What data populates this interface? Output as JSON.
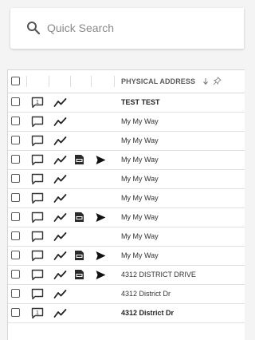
{
  "search": {
    "placeholder": "Quick Search",
    "value": ""
  },
  "grid": {
    "column_header": "PHYSICAL ADDRESS",
    "sort": "descending",
    "rows": [
      {
        "address": "TEST TEST",
        "bold": true,
        "note": "count",
        "note_count": "1",
        "has_pdf": false,
        "has_send": false
      },
      {
        "address": "My My Way",
        "bold": false,
        "note": "empty",
        "note_count": "",
        "has_pdf": false,
        "has_send": false
      },
      {
        "address": "My My Way",
        "bold": false,
        "note": "empty",
        "note_count": "",
        "has_pdf": false,
        "has_send": false
      },
      {
        "address": "My My Way",
        "bold": false,
        "note": "empty",
        "note_count": "",
        "has_pdf": true,
        "has_send": true
      },
      {
        "address": "My My Way",
        "bold": false,
        "note": "empty",
        "note_count": "",
        "has_pdf": false,
        "has_send": false
      },
      {
        "address": "My My Way",
        "bold": false,
        "note": "empty",
        "note_count": "",
        "has_pdf": false,
        "has_send": false
      },
      {
        "address": "My My Way",
        "bold": false,
        "note": "empty",
        "note_count": "",
        "has_pdf": true,
        "has_send": true
      },
      {
        "address": "My My Way",
        "bold": false,
        "note": "empty",
        "note_count": "",
        "has_pdf": false,
        "has_send": false
      },
      {
        "address": "My My Way",
        "bold": false,
        "note": "empty",
        "note_count": "",
        "has_pdf": true,
        "has_send": true
      },
      {
        "address": "4312 DISTRICT DRIVE",
        "bold": false,
        "note": "empty",
        "note_count": "",
        "has_pdf": true,
        "has_send": true
      },
      {
        "address": "4312 District Dr",
        "bold": false,
        "note": "empty",
        "note_count": "",
        "has_pdf": false,
        "has_send": false
      },
      {
        "address": "4312 District Dr",
        "bold": true,
        "note": "count",
        "note_count": "1",
        "has_pdf": false,
        "has_send": false
      }
    ]
  },
  "colors": {
    "icon": "#333333",
    "border": "#d6d6d6",
    "background": "#f4f4f4"
  }
}
